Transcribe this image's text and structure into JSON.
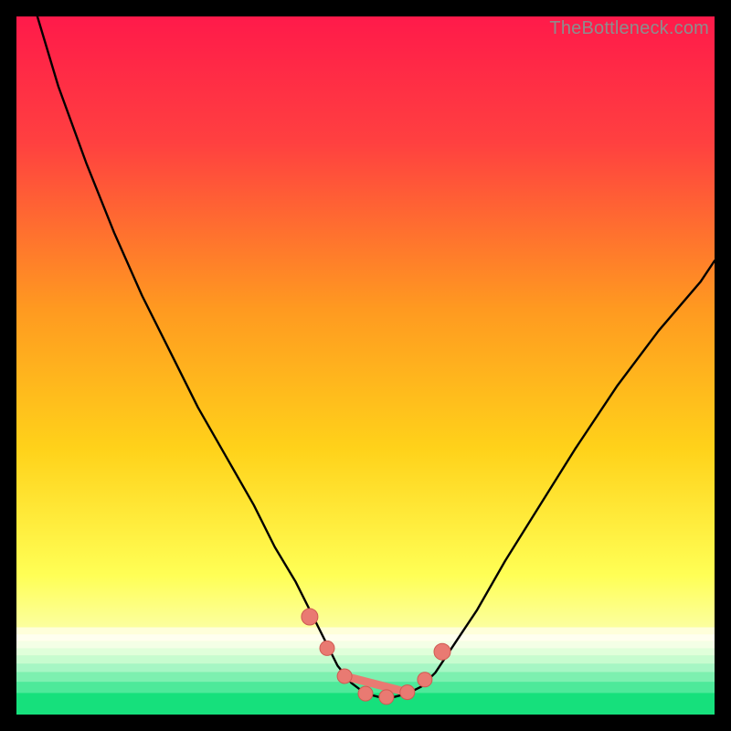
{
  "watermark": "TheBottleneck.com",
  "colors": {
    "bg": "#000000",
    "gradient_top": "#ff1a4a",
    "gradient_mid1": "#ff7a2a",
    "gradient_mid2": "#ffd21a",
    "gradient_mid3": "#ffff60",
    "gradient_mid4": "#f7ffb0",
    "gradient_bottom": "#12e07a",
    "curve": "#000000",
    "dot_fill": "#e97a72",
    "dot_stroke": "#cf5a52"
  },
  "chart_data": {
    "type": "line",
    "title": "",
    "xlabel": "",
    "ylabel": "",
    "xlim": [
      0,
      100
    ],
    "ylim": [
      0,
      100
    ],
    "grid": false,
    "series": [
      {
        "name": "bottleneck-curve",
        "x": [
          3,
          6,
          10,
          14,
          18,
          22,
          26,
          30,
          34,
          37,
          40,
          42,
          44,
          46,
          48,
          50,
          52,
          54,
          56,
          58,
          60,
          62,
          66,
          70,
          75,
          80,
          86,
          92,
          98,
          100
        ],
        "y": [
          100,
          90,
          79,
          69,
          60,
          52,
          44,
          37,
          30,
          24,
          19,
          15,
          11,
          7,
          4.5,
          3,
          2.5,
          2.5,
          3,
          4,
          6,
          9,
          15,
          22,
          30,
          38,
          47,
          55,
          62,
          65
        ]
      }
    ],
    "markers": {
      "name": "highlighted-points",
      "x": [
        42,
        44.5,
        47,
        50,
        53,
        56,
        58.5,
        61
      ],
      "y": [
        14,
        9.5,
        5.5,
        3,
        2.5,
        3.2,
        5,
        9
      ]
    }
  }
}
